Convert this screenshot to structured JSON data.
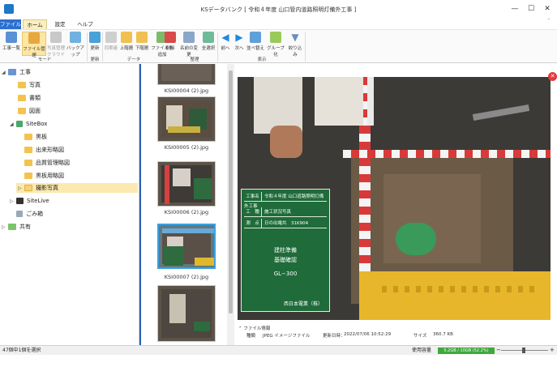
{
  "window": {
    "title": "KSデータバンク [ 令和４年度 山口管内道路照明灯備外工事 ]",
    "controls": [
      "—",
      "☐",
      "✕"
    ]
  },
  "tabs": [
    "ファイル",
    "ホーム",
    "設定",
    "ヘルプ"
  ],
  "ribbon": {
    "buttons": [
      {
        "label": "工事一覧",
        "icon": "project-list-icon"
      },
      {
        "label": "ファイル管理",
        "icon": "file-manage-icon",
        "active": true
      },
      {
        "label": "写真管理",
        "sub": "クラウド",
        "icon": "cloud-photo-icon",
        "disabled": true
      },
      {
        "label": "バックアップ",
        "icon": "backup-icon"
      },
      {
        "label": "更新",
        "icon": "refresh-icon"
      },
      {
        "label": "同期者",
        "icon": "sync-user-icon",
        "disabled": true
      },
      {
        "label": "上階層",
        "icon": "up-folder-icon"
      },
      {
        "label": "下階層",
        "icon": "down-folder-icon"
      },
      {
        "label": "ファイルを追加",
        "icon": "add-file-icon"
      },
      {
        "label": "削除",
        "icon": "delete-icon"
      },
      {
        "label": "名前の変更",
        "icon": "rename-icon"
      },
      {
        "label": "全選択",
        "icon": "select-all-icon"
      },
      {
        "label": "前へ",
        "icon": "prev-icon"
      },
      {
        "label": "次へ",
        "icon": "next-icon"
      },
      {
        "label": "並べ替え",
        "icon": "sort-icon"
      },
      {
        "label": "グループ化",
        "icon": "group-icon"
      },
      {
        "label": "絞り込み",
        "icon": "filter-icon"
      }
    ],
    "groups": [
      "モード",
      "更新",
      "データ",
      "整理",
      "表示"
    ]
  },
  "tree": [
    {
      "label": "工事",
      "level": 0,
      "icon": "project-icon",
      "toggle": "◢"
    },
    {
      "label": "写真",
      "level": 1,
      "icon": "folder-icon"
    },
    {
      "label": "書類",
      "level": 1,
      "icon": "folder-icon"
    },
    {
      "label": "図面",
      "level": 1,
      "icon": "folder-icon"
    },
    {
      "label": "SiteBox",
      "level": 1,
      "icon": "sitebox-icon",
      "toggle": "◢"
    },
    {
      "label": "黒板",
      "level": 2,
      "icon": "folder-icon"
    },
    {
      "label": "出来形略図",
      "level": 2,
      "icon": "folder-icon"
    },
    {
      "label": "品質管理略図",
      "level": 2,
      "icon": "folder-icon"
    },
    {
      "label": "黒板用略図",
      "level": 2,
      "icon": "folder-icon"
    },
    {
      "label": "撮影写真",
      "level": 2,
      "icon": "folder-open-icon",
      "selected": true,
      "toggle": "▷"
    },
    {
      "label": "SiteLive",
      "level": 1,
      "icon": "sitelive-icon",
      "toggle": "▷"
    },
    {
      "label": "ごみ箱",
      "level": 1,
      "icon": "trash-icon"
    },
    {
      "label": "共有",
      "level": 0,
      "icon": "share-icon",
      "toggle": "▷"
    }
  ],
  "thumbnails": [
    {
      "label": "KSI00004 (2).jpg"
    },
    {
      "label": "KSI00005 (2).jpg"
    },
    {
      "label": "KSI00006 (2).jpg"
    },
    {
      "label": "KSI00007 (2).jpg",
      "selected": true
    },
    {
      "label": ""
    }
  ],
  "board": {
    "rows": [
      {
        "key": "工事名",
        "value": "令和４年度 山口道路照明灯備外工事"
      },
      {
        "key": "工　種",
        "value": "施工状況写真"
      },
      {
        "key": "測　点",
        "value": "日の出電共　31K904"
      }
    ],
    "lines": [
      "建柱準備",
      "基礎確認",
      "GL−300"
    ],
    "company": "西日本電業（株）"
  },
  "file_info": {
    "header": "ファイル情報",
    "type_label": "種類",
    "type_value": "JPEG イメージファイル",
    "updated_label": "更新日時：",
    "updated_value": "2022/07/06 10:52:29",
    "size_label": "サイズ",
    "size_value": "360.7 KB"
  },
  "status": {
    "selection": "47個中1個を選択",
    "usage_label": "使用容量",
    "usage_value": "5.2GB / 10GB (52.2%)",
    "usage_fraction": 0.522
  }
}
